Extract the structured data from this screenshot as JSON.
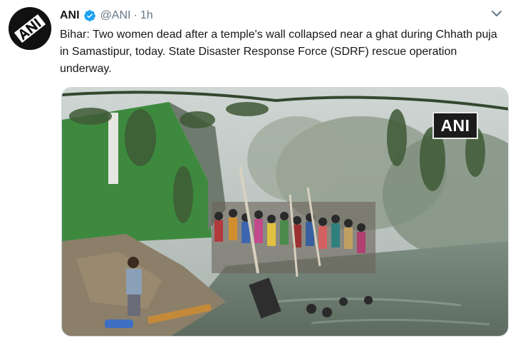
{
  "tweet": {
    "author": {
      "display_name": "ANI",
      "handle": "@ANI",
      "verified": true,
      "avatar_icon": "ani-logo-avatar"
    },
    "separator": "·",
    "timestamp": "1h",
    "text": "Bihar: Two women dead after a temple's wall collapsed near a ghat during Chhath puja in Samastipur, today. State Disaster Response Force (SDRF) rescue operation underway.",
    "media": {
      "watermark": "ANI"
    },
    "menu_icon": "chevron-down-icon"
  },
  "colors": {
    "text": "#14171a",
    "secondary": "#657786",
    "verified_blue": "#1da1f2"
  }
}
